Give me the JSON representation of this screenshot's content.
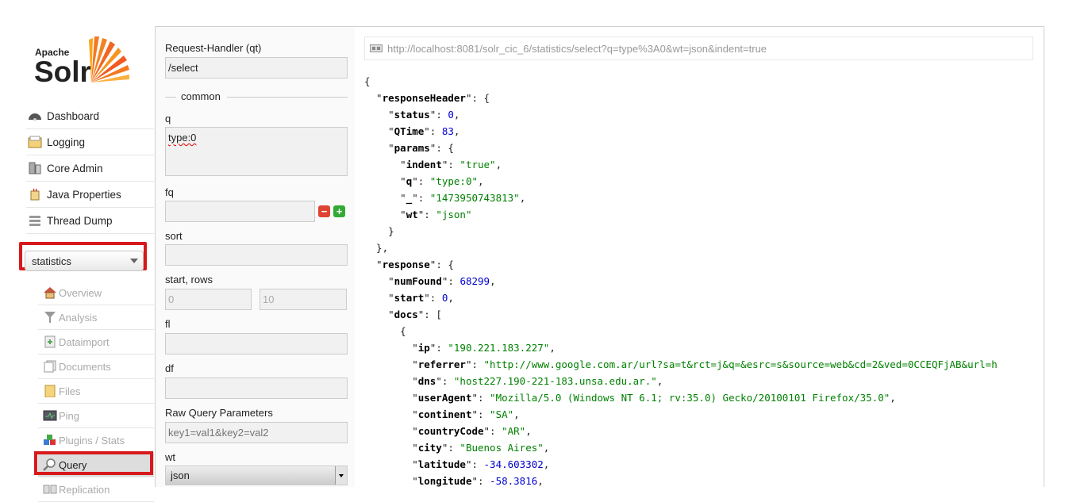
{
  "logo": {
    "apache": "Apache",
    "solr": "Solr"
  },
  "main_nav": [
    {
      "label": "Dashboard",
      "icon": "dashboard-icon"
    },
    {
      "label": "Logging",
      "icon": "logging-icon"
    },
    {
      "label": "Core Admin",
      "icon": "core-admin-icon"
    },
    {
      "label": "Java Properties",
      "icon": "java-properties-icon"
    },
    {
      "label": "Thread Dump",
      "icon": "thread-dump-icon"
    }
  ],
  "core_selector": {
    "value": "statistics"
  },
  "core_nav": [
    {
      "label": "Overview",
      "icon": "overview-icon"
    },
    {
      "label": "Analysis",
      "icon": "analysis-icon"
    },
    {
      "label": "Dataimport",
      "icon": "dataimport-icon"
    },
    {
      "label": "Documents",
      "icon": "documents-icon"
    },
    {
      "label": "Files",
      "icon": "files-icon"
    },
    {
      "label": "Ping",
      "icon": "ping-icon"
    },
    {
      "label": "Plugins / Stats",
      "icon": "plugins-icon"
    },
    {
      "label": "Query",
      "icon": "query-icon",
      "active": true
    },
    {
      "label": "Replication",
      "icon": "replication-icon"
    }
  ],
  "form": {
    "request_handler_label": "Request-Handler (qt)",
    "request_handler_value": "/select",
    "common_legend": "common",
    "q_label": "q",
    "q_value": "type:0",
    "fq_label": "fq",
    "fq_value": "",
    "sort_label": "sort",
    "start_rows_label": "start, rows",
    "start_value": "0",
    "rows_value": "10",
    "fl_label": "fl",
    "df_label": "df",
    "raw_params_label": "Raw Query Parameters",
    "raw_params_placeholder": "key1=val1&key2=val2",
    "wt_label": "wt",
    "wt_value": "json"
  },
  "result": {
    "url": "http://localhost:8081/solr_cic_6/statistics/select?q=type%3A0&wt=json&indent=true",
    "json_lines": [
      [
        [
          "p",
          "{"
        ]
      ],
      [
        [
          "p",
          "  \""
        ],
        [
          "k",
          "responseHeader"
        ],
        [
          "p",
          "\": {"
        ]
      ],
      [
        [
          "p",
          "    \""
        ],
        [
          "k",
          "status"
        ],
        [
          "p",
          "\": "
        ],
        [
          "n",
          "0"
        ],
        [
          "p",
          ","
        ]
      ],
      [
        [
          "p",
          "    \""
        ],
        [
          "k",
          "QTime"
        ],
        [
          "p",
          "\": "
        ],
        [
          "n",
          "83"
        ],
        [
          "p",
          ","
        ]
      ],
      [
        [
          "p",
          "    \""
        ],
        [
          "k",
          "params"
        ],
        [
          "p",
          "\": {"
        ]
      ],
      [
        [
          "p",
          "      \""
        ],
        [
          "k",
          "indent"
        ],
        [
          "p",
          "\": "
        ],
        [
          "s",
          "\"true\""
        ],
        [
          "p",
          ","
        ]
      ],
      [
        [
          "p",
          "      \""
        ],
        [
          "k",
          "q"
        ],
        [
          "p",
          "\": "
        ],
        [
          "s",
          "\"type:0\""
        ],
        [
          "p",
          ","
        ]
      ],
      [
        [
          "p",
          "      \""
        ],
        [
          "k",
          "_"
        ],
        [
          "p",
          "\": "
        ],
        [
          "s",
          "\"1473950743813\""
        ],
        [
          "p",
          ","
        ]
      ],
      [
        [
          "p",
          "      \""
        ],
        [
          "k",
          "wt"
        ],
        [
          "p",
          "\": "
        ],
        [
          "s",
          "\"json\""
        ]
      ],
      [
        [
          "p",
          "    }"
        ]
      ],
      [
        [
          "p",
          "  },"
        ]
      ],
      [
        [
          "p",
          "  \""
        ],
        [
          "k",
          "response"
        ],
        [
          "p",
          "\": {"
        ]
      ],
      [
        [
          "p",
          "    \""
        ],
        [
          "k",
          "numFound"
        ],
        [
          "p",
          "\": "
        ],
        [
          "n",
          "68299"
        ],
        [
          "p",
          ","
        ]
      ],
      [
        [
          "p",
          "    \""
        ],
        [
          "k",
          "start"
        ],
        [
          "p",
          "\": "
        ],
        [
          "n",
          "0"
        ],
        [
          "p",
          ","
        ]
      ],
      [
        [
          "p",
          "    \""
        ],
        [
          "k",
          "docs"
        ],
        [
          "p",
          "\": ["
        ]
      ],
      [
        [
          "p",
          "      {"
        ]
      ],
      [
        [
          "p",
          "        \""
        ],
        [
          "k",
          "ip"
        ],
        [
          "p",
          "\": "
        ],
        [
          "s",
          "\"190.221.183.227\""
        ],
        [
          "p",
          ","
        ]
      ],
      [
        [
          "p",
          "        \""
        ],
        [
          "k",
          "referrer"
        ],
        [
          "p",
          "\": "
        ],
        [
          "s",
          "\"http://www.google.com.ar/url?sa=t&rct=j&q=&esrc=s&source=web&cd=2&ved=0CCEQFjAB&url=h"
        ]
      ],
      [
        [
          "p",
          "        \""
        ],
        [
          "k",
          "dns"
        ],
        [
          "p",
          "\": "
        ],
        [
          "s",
          "\"host227.190-221-183.unsa.edu.ar.\""
        ],
        [
          "p",
          ","
        ]
      ],
      [
        [
          "p",
          "        \""
        ],
        [
          "k",
          "userAgent"
        ],
        [
          "p",
          "\": "
        ],
        [
          "s",
          "\"Mozilla/5.0 (Windows NT 6.1; rv:35.0) Gecko/20100101 Firefox/35.0\""
        ],
        [
          "p",
          ","
        ]
      ],
      [
        [
          "p",
          "        \""
        ],
        [
          "k",
          "continent"
        ],
        [
          "p",
          "\": "
        ],
        [
          "s",
          "\"SA\""
        ],
        [
          "p",
          ","
        ]
      ],
      [
        [
          "p",
          "        \""
        ],
        [
          "k",
          "countryCode"
        ],
        [
          "p",
          "\": "
        ],
        [
          "s",
          "\"AR\""
        ],
        [
          "p",
          ","
        ]
      ],
      [
        [
          "p",
          "        \""
        ],
        [
          "k",
          "city"
        ],
        [
          "p",
          "\": "
        ],
        [
          "s",
          "\"Buenos Aires\""
        ],
        [
          "p",
          ","
        ]
      ],
      [
        [
          "p",
          "        \""
        ],
        [
          "k",
          "latitude"
        ],
        [
          "p",
          "\": "
        ],
        [
          "n",
          "-34.603302"
        ],
        [
          "p",
          ","
        ]
      ],
      [
        [
          "p",
          "        \""
        ],
        [
          "k",
          "longitude"
        ],
        [
          "p",
          "\": "
        ],
        [
          "n",
          "-58.3816"
        ],
        [
          "p",
          ","
        ]
      ]
    ]
  }
}
